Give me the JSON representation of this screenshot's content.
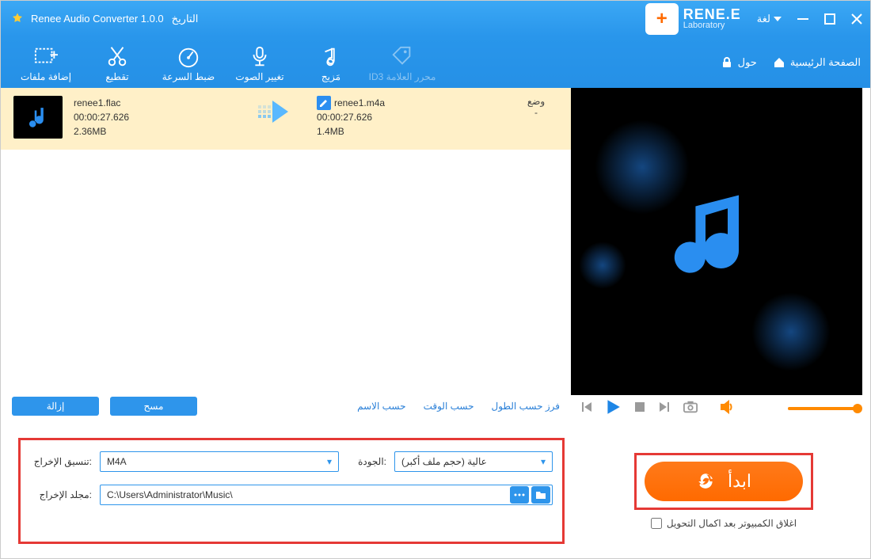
{
  "titlebar": {
    "title": "Renee Audio Converter 1.0.0",
    "history": "التاريخ",
    "logo_big": "RENE.E",
    "logo_small": "Laboratory",
    "lang": "لغة"
  },
  "toolbar": {
    "add_files": "إضافة ملفات",
    "cut": "تقطيع",
    "speed": "ضبط السرعة",
    "voice": "تغيير الصوت",
    "mix": "مَزيج",
    "id3": "ID3 محرر العلامة",
    "about": "حول",
    "home": "الصفحة الرئيسية"
  },
  "file": {
    "src_name": "renee1.flac",
    "src_dur": "00:00:27.626",
    "src_size": "2.36MB",
    "dst_name": "renee1.m4a",
    "dst_dur": "00:00:27.626",
    "dst_size": "1.4MB",
    "status_label": "وضع",
    "status_value": "-"
  },
  "listbar": {
    "remove": "إزالة",
    "clear": "مسح",
    "sort_label": "فرز حسب الطول",
    "by_time": "حسب الوقت",
    "by_name": "حسب الاسم"
  },
  "settings": {
    "format_label": ":تنسيق الإخراج",
    "format_value": "M4A",
    "quality_label": ":الجودة",
    "quality_value": "عالية (حجم ملف أكبر)",
    "folder_label": ":مجلد الإخراج",
    "folder_value": "C:\\Users\\Administrator\\Music\\",
    "start": "ابدأ",
    "shutdown": "اغلاق الكمبيوتر بعد اكمال التحويل"
  }
}
